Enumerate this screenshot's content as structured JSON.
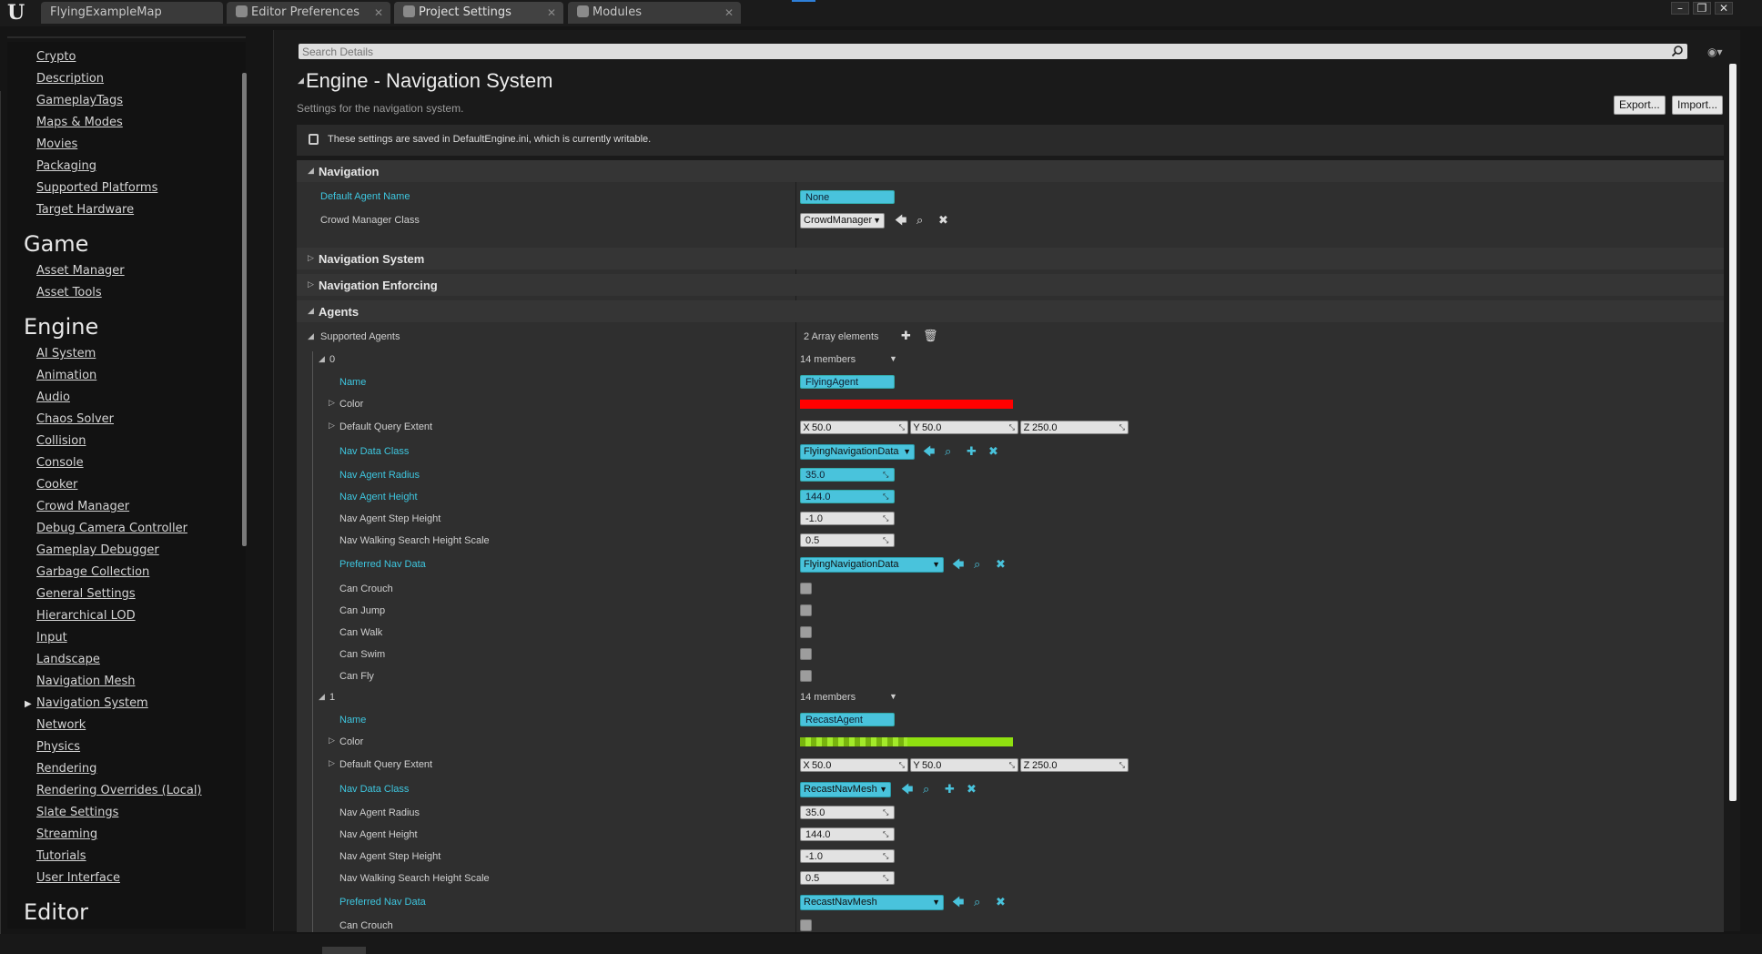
{
  "tabs": [
    {
      "label": "FlyingExampleMap"
    },
    {
      "label": "Editor Preferences"
    },
    {
      "label": "Project Settings"
    },
    {
      "label": "Modules"
    }
  ],
  "window_controls": {
    "minimize": "–",
    "maximize": "❐",
    "close": "✕"
  },
  "sidebar": {
    "items_top": [
      "Crypto",
      "Description",
      "GameplayTags",
      "Maps & Modes",
      "Movies",
      "Packaging",
      "Supported Platforms",
      "Target Hardware"
    ],
    "section_game": "Game",
    "items_game": [
      "Asset Manager",
      "Asset Tools"
    ],
    "section_engine": "Engine",
    "items_engine": [
      "AI System",
      "Animation",
      "Audio",
      "Chaos Solver",
      "Collision",
      "Console",
      "Cooker",
      "Crowd Manager",
      "Debug Camera Controller",
      "Gameplay Debugger",
      "Garbage Collection",
      "General Settings",
      "Hierarchical LOD",
      "Input",
      "Landscape",
      "Navigation Mesh",
      "Navigation System",
      "Network",
      "Physics",
      "Rendering",
      "Rendering Overrides (Local)",
      "Slate Settings",
      "Streaming",
      "Tutorials",
      "User Interface"
    ],
    "section_editor": "Editor",
    "selected": "Navigation System"
  },
  "search": {
    "placeholder": "Search Details"
  },
  "header": {
    "title": "Engine - Navigation System",
    "subtitle": "Settings for the navigation system.",
    "export_label": "Export...",
    "import_label": "Import..."
  },
  "notice": {
    "text": "These settings are saved in DefaultEngine.ini, which is currently writable."
  },
  "navigation": {
    "label": "Navigation",
    "default_agent_name_label": "Default Agent Name",
    "default_agent_name_value": "None",
    "crowd_manager_class_label": "Crowd Manager Class",
    "crowd_manager_class_value": "CrowdManager"
  },
  "categories": {
    "navigation_system": "Navigation System",
    "navigation_enforcing": "Navigation Enforcing",
    "agents": "Agents"
  },
  "supported_agents": {
    "label": "Supported Agents",
    "count_text": "2 Array elements",
    "agents": [
      {
        "index": "0",
        "members": "14 members",
        "name_label": "Name",
        "name_value": "FlyingAgent",
        "color_label": "Color",
        "color": "#ff0000",
        "extent_label": "Default Query Extent",
        "extent_x": "50.0",
        "extent_y": "50.0",
        "extent_z": "250.0",
        "nav_data_class_label": "Nav Data Class",
        "nav_data_class_value": "FlyingNavigationData",
        "radius_label": "Nav Agent Radius",
        "radius_value": "35.0",
        "height_label": "Nav Agent Height",
        "height_value": "144.0",
        "step_height_label": "Nav Agent Step Height",
        "step_height_value": "-1.0",
        "walk_scale_label": "Nav Walking Search Height Scale",
        "walk_scale_value": "0.5",
        "preferred_label": "Preferred Nav Data",
        "preferred_value": "FlyingNavigationData",
        "can_crouch": "Can Crouch",
        "can_jump": "Can Jump",
        "can_walk": "Can Walk",
        "can_swim": "Can Swim",
        "can_fly": "Can Fly"
      },
      {
        "index": "1",
        "members": "14 members",
        "name_label": "Name",
        "name_value": "RecastAgent",
        "color_label": "Color",
        "color": "#8fe010",
        "extent_label": "Default Query Extent",
        "extent_x": "50.0",
        "extent_y": "50.0",
        "extent_z": "250.0",
        "nav_data_class_label": "Nav Data Class",
        "nav_data_class_value": "RecastNavMesh",
        "radius_label": "Nav Agent Radius",
        "radius_value": "35.0",
        "height_label": "Nav Agent Height",
        "height_value": "144.0",
        "step_height_label": "Nav Agent Step Height",
        "step_height_value": "-1.0",
        "walk_scale_label": "Nav Walking Search Height Scale",
        "walk_scale_value": "0.5",
        "preferred_label": "Preferred Nav Data",
        "preferred_value": "RecastNavMesh",
        "can_crouch": "Can Crouch"
      }
    ]
  },
  "colors": {
    "accent": "#49c3dc",
    "modified_label": "#3ec6df"
  }
}
